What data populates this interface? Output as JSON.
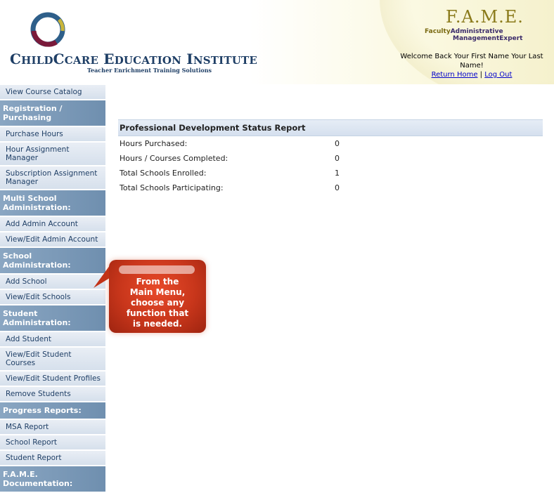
{
  "header": {
    "logo_big_c": "C",
    "logo_hildcare": "HILD",
    "logo_care": "CARE",
    "logo_e": " E",
    "logo_ducation": "DUCATION",
    "logo_i": " I",
    "logo_nstitute": "NSTITUTE",
    "tagline": "Teacher Enrichment Training Solutions",
    "fame_title": "F.A.M.E.",
    "fame_faculty": "Faculty",
    "fame_administrative": "Administrative",
    "fame_sub2": "ManagementExpert",
    "welcome_text": "Welcome Back Your First Name Your Last Name!",
    "return_home": "Return Home",
    "separator": "|",
    "log_out": "Log Out"
  },
  "sidebar": {
    "items": [
      {
        "type": "item",
        "label": "View Course Catalog"
      },
      {
        "type": "header",
        "label": "Registration / Purchasing"
      },
      {
        "type": "item",
        "label": "Purchase Hours"
      },
      {
        "type": "item",
        "label": "Hour Assignment Manager"
      },
      {
        "type": "item",
        "label": "Subscription Assignment Manager"
      },
      {
        "type": "header",
        "label": "Multi School Administration:"
      },
      {
        "type": "item",
        "label": "Add Admin Account"
      },
      {
        "type": "item",
        "label": "View/Edit Admin Account"
      },
      {
        "type": "header",
        "label": "School Administration:"
      },
      {
        "type": "item",
        "label": "Add School"
      },
      {
        "type": "item",
        "label": "View/Edit Schools"
      },
      {
        "type": "header",
        "label": "Student Administration:"
      },
      {
        "type": "item",
        "label": "Add Student"
      },
      {
        "type": "item",
        "label": "View/Edit Student Courses"
      },
      {
        "type": "item",
        "label": "View/Edit Student Profiles"
      },
      {
        "type": "item",
        "label": "Remove Students"
      },
      {
        "type": "header",
        "label": "Progress Reports:"
      },
      {
        "type": "item",
        "label": "MSA Report"
      },
      {
        "type": "item",
        "label": "School Report"
      },
      {
        "type": "item",
        "label": "Student Report"
      },
      {
        "type": "header",
        "label": "F.A.M.E. Documentation:"
      }
    ]
  },
  "report": {
    "title": "Professional Development Status Report",
    "rows": [
      {
        "label": "Hours Purchased:",
        "value": "0"
      },
      {
        "label": "Hours / Courses Completed:",
        "value": "0"
      },
      {
        "label": "Total Schools Enrolled:",
        "value": "1"
      },
      {
        "label": "Total Schools Participating:",
        "value": "0"
      }
    ]
  },
  "callout": {
    "text": "From the\nMain Menu,\nchoose any\nfunction that\nis needed."
  },
  "colors": {
    "nav_text": "#1f3f66",
    "nav_header_bg": "#7b98b8",
    "callout_red": "#c8361b",
    "link_blue": "#0000cc"
  }
}
